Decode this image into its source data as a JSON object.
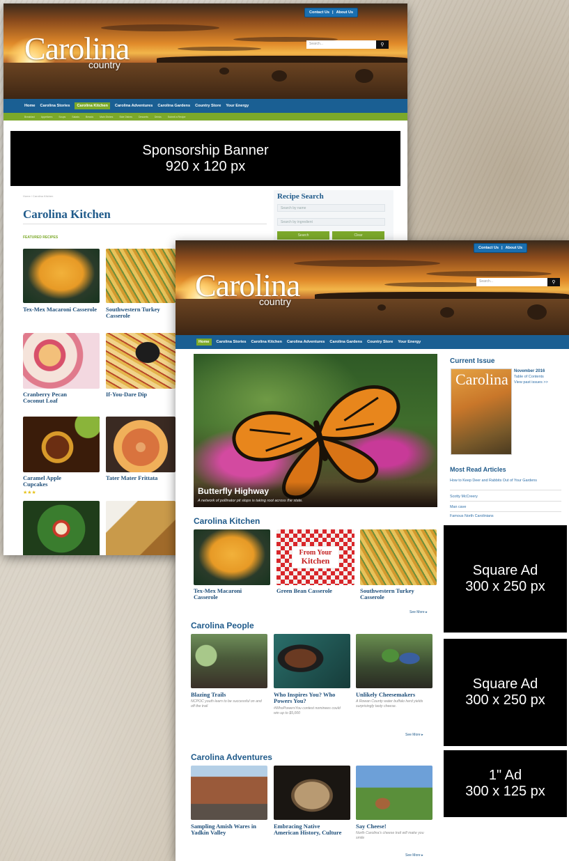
{
  "colors": {
    "nav_blue": "#1a5f93",
    "nav_green": "#7ca92a",
    "heading_blue": "#1f5a8a",
    "ad_black": "#000000"
  },
  "back_page": {
    "top_links": {
      "contact": "Contact Us",
      "sep": "|",
      "about": "About Us"
    },
    "logo": {
      "main": "Carolina",
      "sub": "country"
    },
    "search": {
      "placeholder": "Search...",
      "icon": "search-icon"
    },
    "nav": [
      "Home",
      "Carolina Stories",
      "Carolina Kitchen",
      "Carolina Adventures",
      "Carolina Gardens",
      "Country Store",
      "Your Energy"
    ],
    "nav_active": "Carolina Kitchen",
    "subnav": [
      "Breakfast",
      "Appetizers",
      "Soups",
      "Salads",
      "Breads",
      "Main Dishes",
      "Side Dishes",
      "Desserts",
      "Drinks",
      "Submit a Recipe"
    ],
    "banner": {
      "line1": "Sponsorship Banner",
      "line2": "920 x 120 px"
    },
    "breadcrumb": "Home  /  Carolina Kitchen",
    "page_title": "Carolina Kitchen",
    "featured_label": "FEATURED RECIPES",
    "recipe_search": {
      "title": "Recipe Search",
      "name_placeholder": "Search by name",
      "ingredient_placeholder": "Search by ingredient",
      "search_btn": "Search",
      "clear_btn": "Clear"
    },
    "recipes": [
      {
        "title": "Tex-Mex Macaroni Casserole"
      },
      {
        "title": "Southwestern Turkey Casserole"
      },
      {
        "title": "Cranberry Pecan Coconut Loaf"
      },
      {
        "title": "If-You-Dare Dip"
      },
      {
        "title": "Caramel Apple Cupcakes",
        "rating": "★★★"
      },
      {
        "title": "Tater Mater Frittata"
      }
    ]
  },
  "front_page": {
    "top_links": {
      "contact": "Contact Us",
      "sep": "|",
      "about": "About Us"
    },
    "logo": {
      "main": "Carolina",
      "sub": "country"
    },
    "search": {
      "placeholder": "Search...",
      "icon": "search-icon"
    },
    "nav": [
      "Home",
      "Carolina Stories",
      "Carolina Kitchen",
      "Carolina Adventures",
      "Carolina Gardens",
      "Country Store",
      "Your Energy"
    ],
    "nav_active": "Home",
    "hero": {
      "title": "Butterfly Highway",
      "subtitle": "A network of pollinator pit stops is taking root across the state."
    },
    "current_issue": {
      "heading": "Current Issue",
      "month": "November 2016",
      "toc": "Table of Contents",
      "past": "View past issues >>"
    },
    "most_read": {
      "heading": "Most Read Articles",
      "items": [
        "How to Keep Deer and Rabbits Out of Your Gardens",
        "Scotty McCreery",
        "Man cave",
        "Famous North Carolinians"
      ]
    },
    "kitchen": {
      "heading": "Carolina Kitchen",
      "items": [
        "Tex-Mex Macaroni Casserole",
        "Green Bean Casserole",
        "Southwestern Turkey Casserole"
      ],
      "badge_line1": "From Your",
      "badge_line2": "Kitchen",
      "more": "See More ▸"
    },
    "people": {
      "heading": "Carolina People",
      "items": [
        {
          "title": "Blazing Trails",
          "desc": "NCPOC youth learn to be successful on and off the trail"
        },
        {
          "title": "Who Inspires You? Who Powers You?",
          "desc": "#WhoPowersYou contest nominees could win up to $5,000"
        },
        {
          "title": "Unlikely Cheesemakers",
          "desc": "A Rowan County water buffalo herd yields surprisingly tasty cheese."
        }
      ],
      "more": "See More ▸"
    },
    "adventures": {
      "heading": "Carolina Adventures",
      "items": [
        {
          "title": "Sampling Amish Wares in Yadkin Valley",
          "desc": ""
        },
        {
          "title": "Embracing Native American History, Culture",
          "desc": ""
        },
        {
          "title": "Say Cheese!",
          "desc": "North Carolina's cheese trail will make you smile"
        }
      ],
      "more": "See More ▸"
    }
  },
  "ads": [
    {
      "line1": "Square Ad",
      "line2": "300 x 250 px"
    },
    {
      "line1": "Square Ad",
      "line2": "300 x 250 px"
    },
    {
      "line1": "1\" Ad",
      "line2": "300 x 125 px"
    }
  ]
}
